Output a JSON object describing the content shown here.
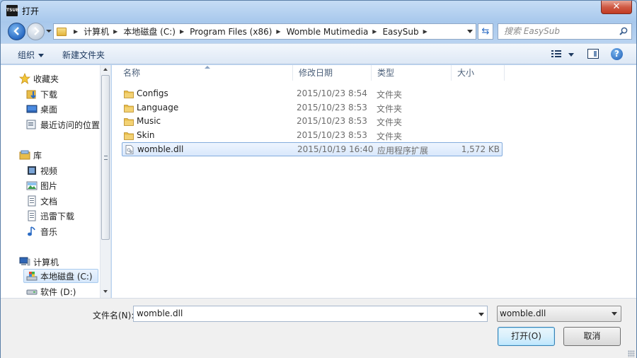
{
  "window": {
    "title": "打开",
    "app_icon_text": "TSUB",
    "close_glyph": "✕"
  },
  "address": {
    "crumbs": [
      "计算机",
      "本地磁盘 (C:)",
      "Program Files (x86)",
      "Womble Mutimedia",
      "EasySub"
    ],
    "search_placeholder": "搜索 EasySub"
  },
  "toolbar": {
    "organize_label": "组织",
    "new_folder_label": "新建文件夹",
    "help_glyph": "?"
  },
  "nav": {
    "favorites": {
      "label": "收藏夹",
      "items": [
        "下载",
        "桌面",
        "最近访问的位置"
      ]
    },
    "libraries": {
      "label": "库",
      "items": [
        "视频",
        "图片",
        "文档",
        "迅雷下载",
        "音乐"
      ]
    },
    "computer": {
      "label": "计算机",
      "items": [
        "本地磁盘 (C:)",
        "软件 (D:)"
      ]
    }
  },
  "columns": {
    "name": "名称",
    "date": "修改日期",
    "type": "类型",
    "size": "大小"
  },
  "files": [
    {
      "name": "Configs",
      "date": "2015/10/23 8:54",
      "type": "文件夹",
      "size": "",
      "kind": "folder"
    },
    {
      "name": "Language",
      "date": "2015/10/23 8:53",
      "type": "文件夹",
      "size": "",
      "kind": "folder"
    },
    {
      "name": "Music",
      "date": "2015/10/23 8:53",
      "type": "文件夹",
      "size": "",
      "kind": "folder"
    },
    {
      "name": "Skin",
      "date": "2015/10/23 8:53",
      "type": "文件夹",
      "size": "",
      "kind": "folder"
    },
    {
      "name": "womble.dll",
      "date": "2015/10/19 16:40",
      "type": "应用程序扩展",
      "size": "1,572 KB",
      "kind": "dll",
      "selected": true
    }
  ],
  "bottom": {
    "filename_label": "文件名(N):",
    "filename_value": "womble.dll",
    "filter_value": "womble.dll",
    "open_label": "打开(O)",
    "cancel_label": "取消"
  },
  "colors": {
    "folder": "#e8bd4a",
    "selection_border": "#84acdd",
    "accent": "#2a6bc4"
  }
}
